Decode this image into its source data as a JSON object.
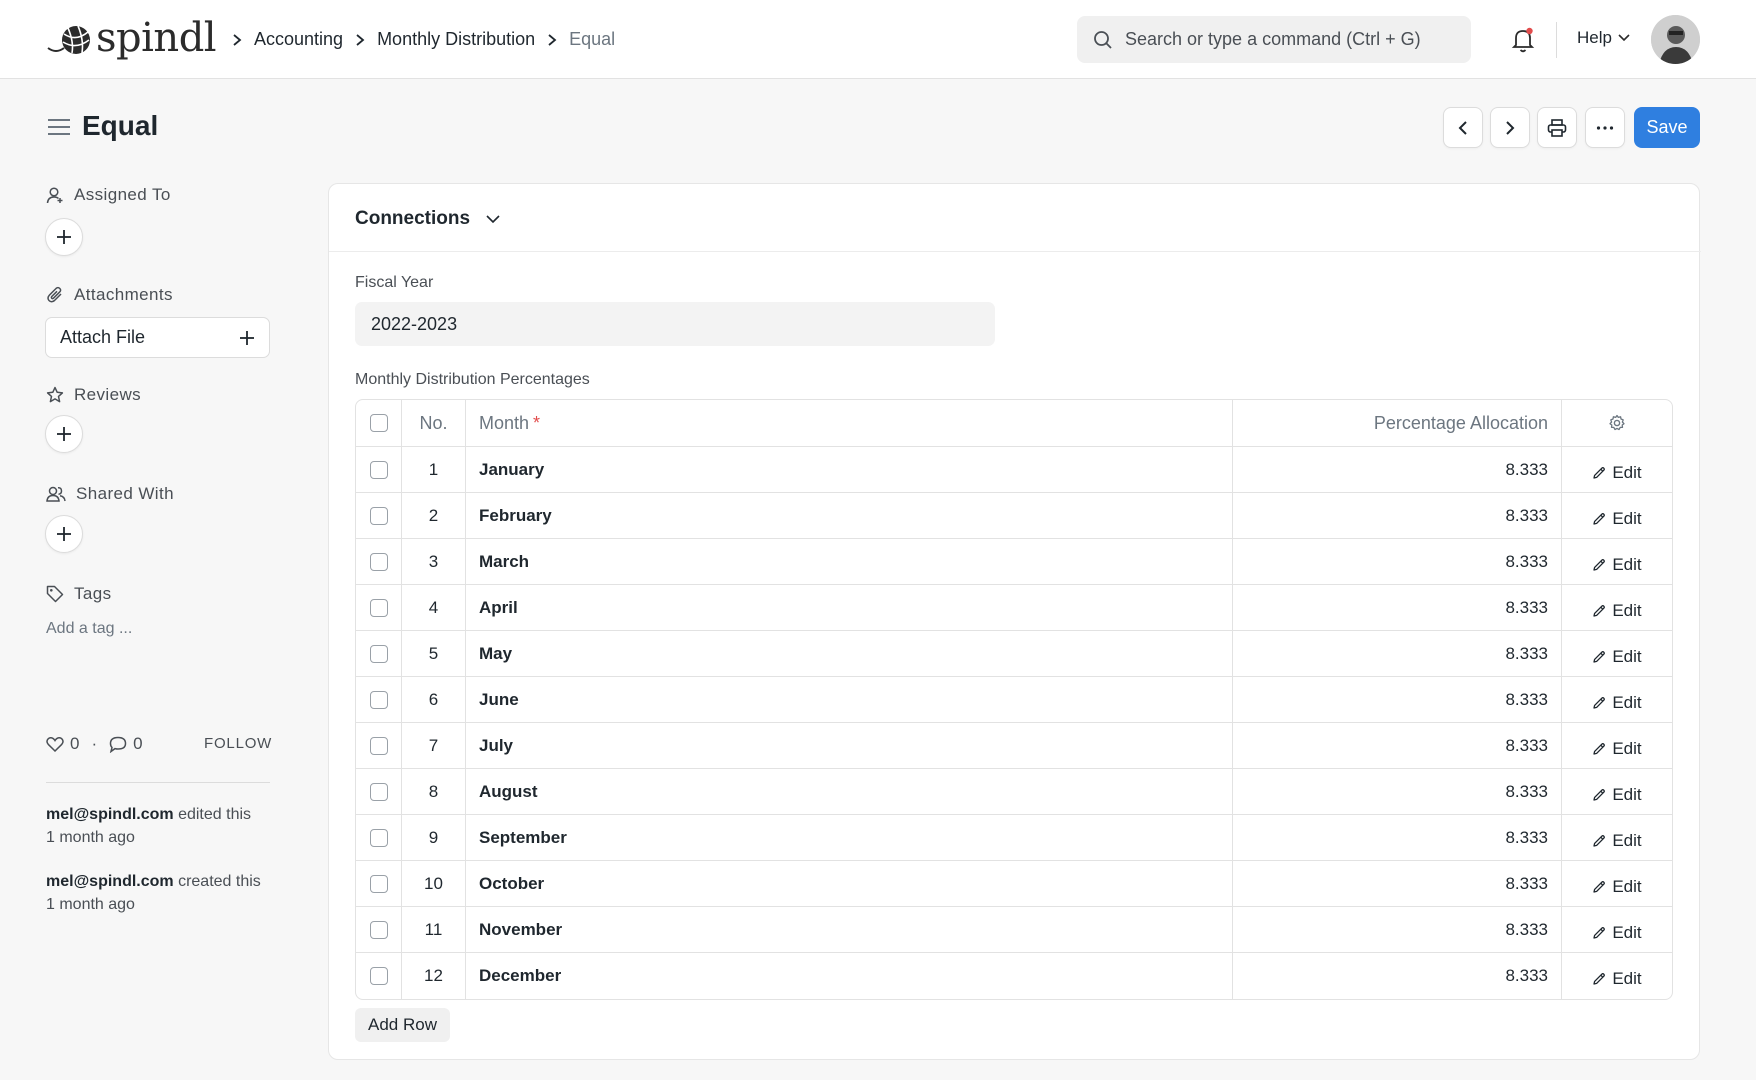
{
  "app": {
    "logo_text": "spindl"
  },
  "breadcrumbs": [
    {
      "label": "Accounting"
    },
    {
      "label": "Monthly Distribution"
    },
    {
      "label": "Equal"
    }
  ],
  "search": {
    "placeholder": "Search or type a command (Ctrl + G)"
  },
  "navbar": {
    "help_label": "Help"
  },
  "page": {
    "title": "Equal",
    "save_label": "Save"
  },
  "sidebar": {
    "assigned_to": "Assigned To",
    "attachments": "Attachments",
    "attach_file": "Attach File",
    "reviews": "Reviews",
    "shared_with": "Shared With",
    "tags": "Tags",
    "add_tag": "Add a tag ...",
    "likes": "0",
    "comments": "0",
    "dot": "·",
    "follow": "FOLLOW",
    "activity": [
      {
        "user": "mel@spindl.com",
        "action": "edited this",
        "time": "1 month ago"
      },
      {
        "user": "mel@spindl.com",
        "action": "created this",
        "time": "1 month ago"
      }
    ]
  },
  "form": {
    "connections_label": "Connections",
    "fiscal_year_label": "Fiscal Year",
    "fiscal_year_value": "2022-2023",
    "table_label": "Monthly Distribution Percentages",
    "columns": {
      "no": "No.",
      "month": "Month",
      "required_mark": "*",
      "percentage": "Percentage Allocation"
    },
    "edit_label": "Edit",
    "rows": [
      {
        "no": "1",
        "month": "January",
        "pct": "8.333"
      },
      {
        "no": "2",
        "month": "February",
        "pct": "8.333"
      },
      {
        "no": "3",
        "month": "March",
        "pct": "8.333"
      },
      {
        "no": "4",
        "month": "April",
        "pct": "8.333"
      },
      {
        "no": "5",
        "month": "May",
        "pct": "8.333"
      },
      {
        "no": "6",
        "month": "June",
        "pct": "8.333"
      },
      {
        "no": "7",
        "month": "July",
        "pct": "8.333"
      },
      {
        "no": "8",
        "month": "August",
        "pct": "8.333"
      },
      {
        "no": "9",
        "month": "September",
        "pct": "8.333"
      },
      {
        "no": "10",
        "month": "October",
        "pct": "8.333"
      },
      {
        "no": "11",
        "month": "November",
        "pct": "8.333"
      },
      {
        "no": "12",
        "month": "December",
        "pct": "8.333"
      }
    ],
    "add_row_label": "Add Row"
  },
  "colors": {
    "primary": "#2f7fe0",
    "required": "#e24c4c",
    "notification_dot": "#e24c4c"
  }
}
